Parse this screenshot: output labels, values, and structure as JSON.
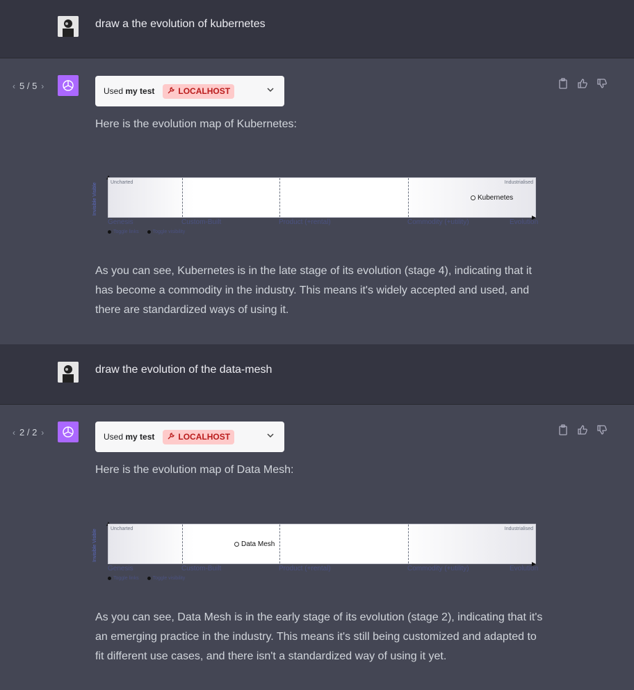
{
  "conversation": [
    {
      "user": {
        "message": "draw a the evolution of kubernetes"
      },
      "assistant": {
        "pager": "5 / 5",
        "plugin": {
          "used_prefix": "Used",
          "plugin_name": "my test",
          "badge": "LOCALHOST"
        },
        "intro": "Here is the evolution map of Kubernetes:",
        "map": {
          "corner_left": "Uncharted",
          "corner_right": "Industrialised",
          "y_label": "Invisible Visible",
          "stages": [
            "Genesis",
            "Custom-Built",
            "Product (+rental)",
            "Commodity (+utility)",
            "Evolution"
          ],
          "component": "Kubernetes",
          "component_evolution": 0.86,
          "component_visibility": 0.5,
          "toggles": [
            "Toggle links",
            "Toggle visibility"
          ]
        },
        "body": "As you can see, Kubernetes is in the late stage of its evolution (stage 4), indicating that it has become a commodity in the industry. This means it's widely accepted and used, and there are standardized ways of using it."
      }
    },
    {
      "user": {
        "message": "draw the evolution of the data-mesh"
      },
      "assistant": {
        "pager": "2 / 2",
        "plugin": {
          "used_prefix": "Used",
          "plugin_name": "my test",
          "badge": "LOCALHOST"
        },
        "intro": "Here is the evolution map of Data Mesh:",
        "map": {
          "corner_left": "Uncharted",
          "corner_right": "Industrialised",
          "y_label": "Invisible Visible",
          "stages": [
            "Genesis",
            "Custom-Built",
            "Product (+rental)",
            "Commodity (+utility)",
            "Evolution"
          ],
          "component": "Data Mesh",
          "component_evolution": 0.3,
          "component_visibility": 0.5,
          "toggles": [
            "Toggle links",
            "Toggle visibility"
          ]
        },
        "body": "As you can see, Data Mesh is in the early stage of its evolution (stage 2), indicating that it's an emerging practice in the industry. This means it's still being customized and adapted to fit different use cases, and there isn't a standardized way of using it yet."
      }
    }
  ],
  "icons": {
    "copy": "clipboard-icon",
    "like": "thumbs-up-icon",
    "dislike": "thumbs-down-icon",
    "plugin": "wrench-icon",
    "expand": "chevron-down-icon"
  },
  "colors": {
    "user_bg": "#343541",
    "assistant_bg": "#444654",
    "gpt_logo": "#ab68ff",
    "badge_bg": "#fecaca",
    "badge_text": "#b91c1c"
  }
}
